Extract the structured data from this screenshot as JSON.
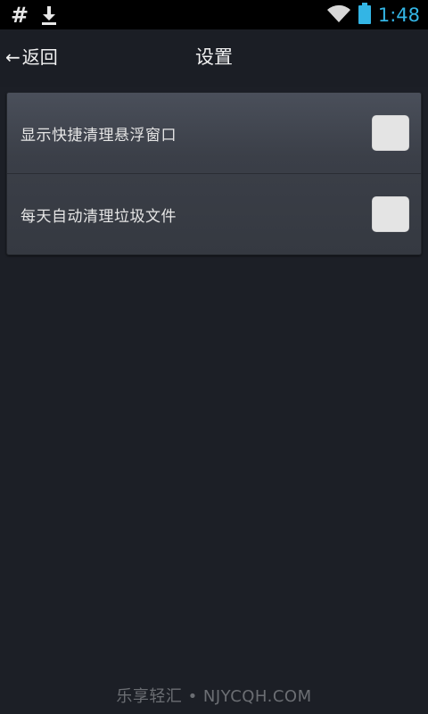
{
  "status_bar": {
    "left_icons": [
      "hash-icon",
      "download-icon"
    ],
    "hash_glyph": "#",
    "right_icons": [
      "wifi-icon",
      "battery-icon"
    ],
    "time": "1:48",
    "time_color": "#33b5e5"
  },
  "header": {
    "back_label": "返回",
    "back_arrow": "←",
    "title": "设置"
  },
  "settings": [
    {
      "label": "显示快捷清理悬浮窗口",
      "checked": false
    },
    {
      "label": "每天自动清理垃圾文件",
      "checked": false
    }
  ],
  "watermark": "乐享轻汇 • NJYCQH.COM",
  "colors": {
    "background": "#1c1f26",
    "card": "#3b3f48",
    "accent": "#33b5e5",
    "checkbox": "#e4e4e4"
  }
}
